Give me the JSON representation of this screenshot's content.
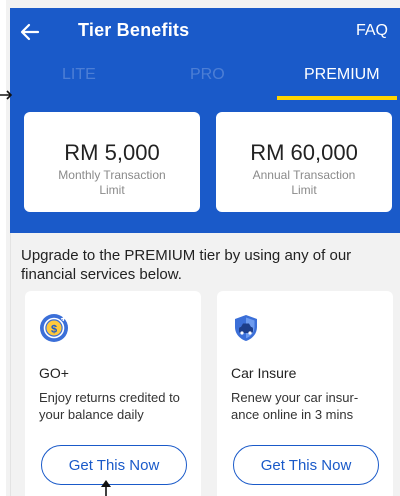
{
  "header": {
    "title": "Tier Benefits",
    "faq_label": "FAQ",
    "back_icon": "arrow-left-icon"
  },
  "tabs": [
    {
      "label": "LITE",
      "active": false
    },
    {
      "label": "PRO",
      "active": false
    },
    {
      "label": "PREMIUM",
      "active": true
    }
  ],
  "limits": [
    {
      "amount": "RM 5,000",
      "label": "Monthly Transaction Limit"
    },
    {
      "amount": "RM 60,000",
      "label": "Annual Transaction Limit"
    }
  ],
  "intro_text": "Upgrade to the PREMIUM tier by using any of our financial services below.",
  "services": [
    {
      "name": "GO+",
      "description": "Enjoy returns credited to your balance daily",
      "button_label": "Get This Now",
      "icon": "go-plus-coin-icon"
    },
    {
      "name": "Car Insure",
      "description": "Renew your car insur-ance online in 3 mins",
      "button_label": "Get This Now",
      "icon": "car-shield-icon"
    }
  ],
  "colors": {
    "primary": "#1a5ac9",
    "tab_indicator": "#ffd400",
    "background": "#f2f2f2"
  }
}
